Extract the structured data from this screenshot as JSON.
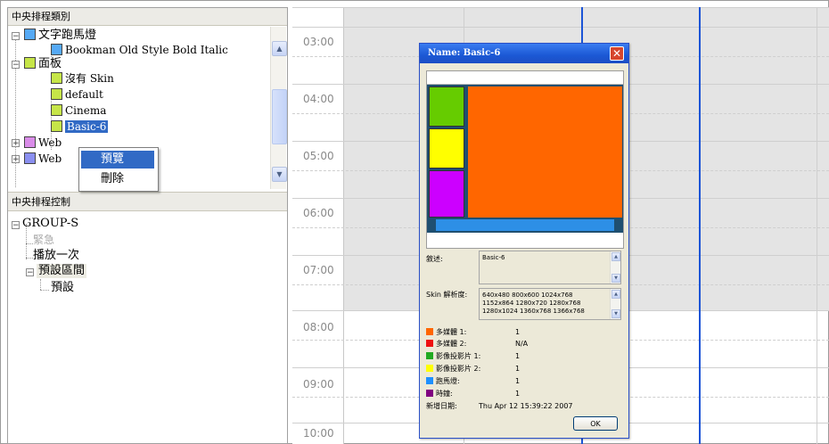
{
  "panels": {
    "category_title": "中央排程類別",
    "control_title": "中央排程控制"
  },
  "category_tree": {
    "marquee": "文字跑馬燈",
    "marquee_font": "Bookman Old Style Bold Italic",
    "panel": "面板",
    "skin_none": "沒有 Skin",
    "skin_default": "default",
    "skin_cinema": "Cinema",
    "skin_basic6": "Basic-6",
    "web1": "Web",
    "web2": "Web"
  },
  "context_menu": {
    "preview": "預覽",
    "delete": "刪除"
  },
  "control_tree": {
    "group": "GROUP-S",
    "urgent": "緊急",
    "play_once": "播放一次",
    "preset_range": "預設區間",
    "preset": "預設"
  },
  "schedule": {
    "times": [
      "03:00",
      "04:00",
      "05:00",
      "06:00",
      "07:00",
      "08:00",
      "09:00",
      "10:00"
    ]
  },
  "dialog": {
    "title": "Name: Basic-6",
    "description_label": "敘述:",
    "description_value": "Basic-6",
    "resolution_label": "Skin 解析度:",
    "resolution_line1": "640x480 800x600 1024x768",
    "resolution_line2": "1152x864 1280x720 1280x768",
    "resolution_line3": "1280x1024 1360x768 1366x768",
    "legend": [
      {
        "label": "多媒體 1:",
        "value": "1",
        "color": "#ff6600"
      },
      {
        "label": "多媒體 2:",
        "value": "N/A",
        "color": "#ee1111"
      },
      {
        "label": "影像投影片 1:",
        "value": "1",
        "color": "#22aa22"
      },
      {
        "label": "影像投影片 2:",
        "value": "1",
        "color": "#ffff00"
      },
      {
        "label": "跑馬燈:",
        "value": "1",
        "color": "#1e90ff"
      },
      {
        "label": "時鐘:",
        "value": "1",
        "color": "#800080"
      }
    ],
    "date_label": "新增日期:",
    "date_value": "Thu Apr 12 15:39:22 2007",
    "ok_label": "OK"
  },
  "colors": {
    "accent_blue": "#1b54d6",
    "selection": "#316ac5",
    "preview_orange": "#ff6600",
    "preview_green": "#66cc00",
    "preview_yellow": "#ffff00",
    "preview_purple": "#cc00ff",
    "preview_blue": "#2d8fe6"
  }
}
